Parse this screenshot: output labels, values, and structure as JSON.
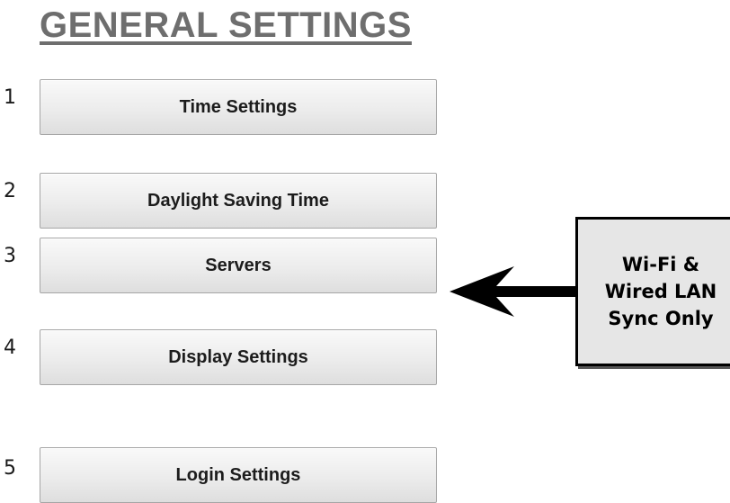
{
  "page": {
    "title": "GENERAL SETTINGS"
  },
  "menu": {
    "items": [
      {
        "number": "1",
        "label": "Time Settings"
      },
      {
        "number": "2",
        "label": "Daylight Saving Time"
      },
      {
        "number": "3",
        "label": "Servers"
      },
      {
        "number": "4",
        "label": "Display Settings"
      },
      {
        "number": "5",
        "label": "Login Settings"
      }
    ]
  },
  "callout": {
    "text": "Wi-Fi &\nWired LAN\nSync Only"
  },
  "colors": {
    "title": "#6e6e6e",
    "button_bg": "#ececec",
    "button_border": "#a6a6a6",
    "callout_bg": "#e6e6e6",
    "arrow": "#000000"
  }
}
